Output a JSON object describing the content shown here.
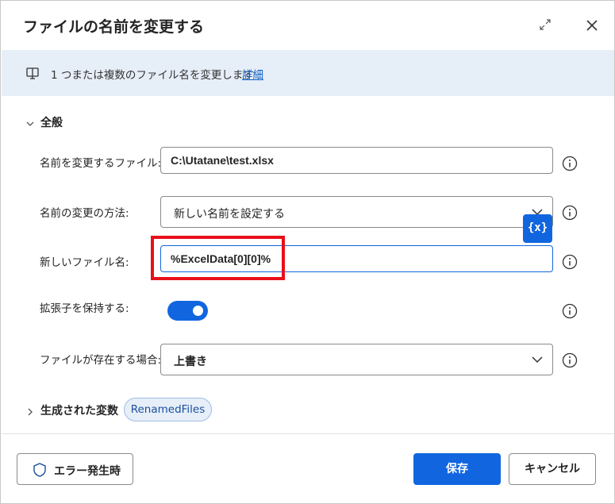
{
  "dialog": {
    "title": "ファイルの名前を変更する"
  },
  "banner": {
    "text": "1 つまたは複数のファイル名を変更します",
    "link": "詳細"
  },
  "section": {
    "title": "全般"
  },
  "fields": {
    "file_label": "名前を変更するファイル:",
    "file_value": "C:\\Utatane\\test.xlsx",
    "method_label": "名前の変更の方法:",
    "method_value": "新しい名前を設定する",
    "new_name_label": "新しいファイル名:",
    "new_name_value": "%ExcelData[0][0]%",
    "keep_ext_label": "拡張子を保持する:",
    "keep_ext_on": true,
    "exists_label": "ファイルが存在する場合:",
    "exists_value": "上書き"
  },
  "variable_button": "{x}",
  "variables": {
    "title": "生成された変数",
    "chip": "RenamedFiles"
  },
  "footer": {
    "error_label": "エラー発生時",
    "save_label": "保存",
    "cancel_label": "キャンセル"
  },
  "colors": {
    "accent": "#1166e0",
    "banner_bg": "#e6eef8",
    "highlight": "#e8101a"
  }
}
